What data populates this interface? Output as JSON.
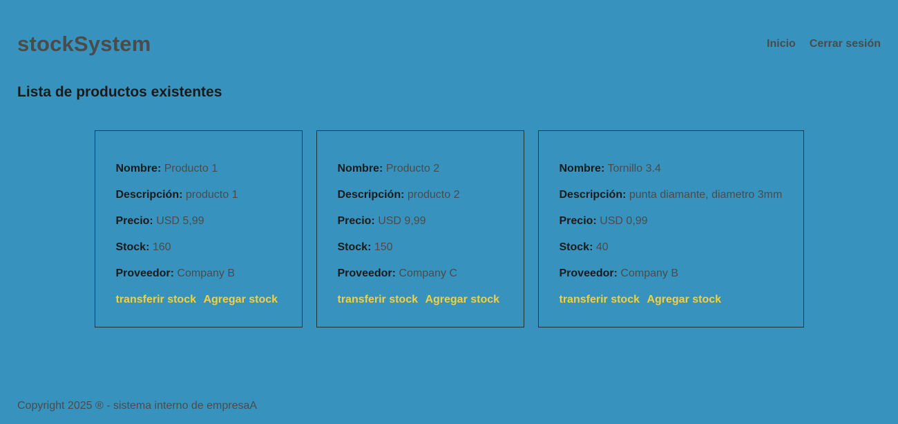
{
  "header": {
    "brand": "stockSystem",
    "nav": {
      "home": "Inicio",
      "logout": "Cerrar sesión"
    }
  },
  "page": {
    "title": "Lista de productos existentes"
  },
  "labels": {
    "name": "Nombre:",
    "description": "Descripción:",
    "price": "Precio:",
    "stock": "Stock:",
    "supplier": "Proveedor:",
    "transfer": "transferir stock",
    "add": "Agregar stock"
  },
  "products": [
    {
      "name": "Producto 1",
      "description": "producto 1",
      "price": "USD 5,99",
      "stock": "160",
      "supplier": "Company B"
    },
    {
      "name": "Producto 2",
      "description": "producto 2",
      "price": "USD 9,99",
      "stock": "150",
      "supplier": "Company C"
    },
    {
      "name": "Tornillo 3.4",
      "description": "punta diamante, diametro 3mm",
      "price": "USD 0,99",
      "stock": "40",
      "supplier": "Company B"
    }
  ],
  "footer": {
    "text": "Copyright 2025 ® - sistema interno de empresaA"
  },
  "colors": {
    "background": "#3793bd",
    "link_accent": "#f4d03f",
    "text_muted": "#4b4b4b",
    "text_dark": "#1a1a1a"
  }
}
